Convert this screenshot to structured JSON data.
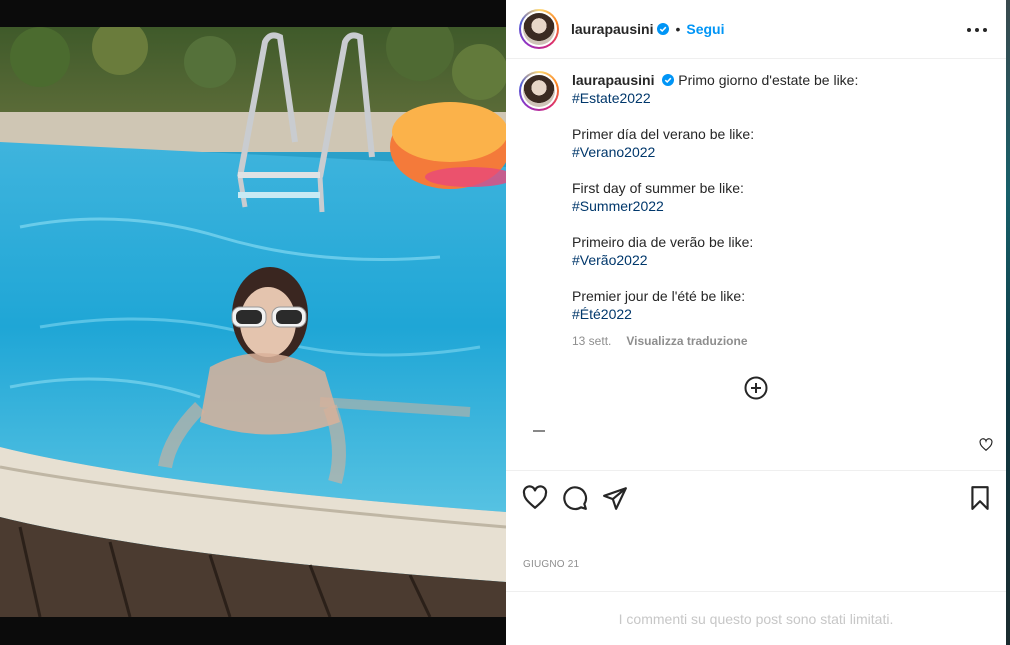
{
  "post": {
    "username": "laurapausini",
    "follow_label": "Segui",
    "separator": "•",
    "verified_icon": "verified-badge-icon",
    "accent_color": "#0095f6"
  },
  "caption": {
    "username": "laurapausini",
    "first_line": "Primo giorno d'estate be like:",
    "blocks": [
      {
        "text": "",
        "hashtag": "#Estate2022"
      },
      {
        "text": "Primer día del verano be like:",
        "hashtag": "#Verano2022"
      },
      {
        "text": "First day of summer be like:",
        "hashtag": "#Summer2022"
      },
      {
        "text": "Primeiro dia de verão be like:",
        "hashtag": "#Verão2022"
      },
      {
        "text": "Premier jour de l'été be like:",
        "hashtag": "#Été2022"
      }
    ],
    "age": "13 sett.",
    "translate_label": "Visualizza traduzione",
    "hashtag_color": "#00376b"
  },
  "footer": {
    "date": "GIUGNO 21",
    "comments_limited": "I commenti su questo post sono stati limitati."
  }
}
